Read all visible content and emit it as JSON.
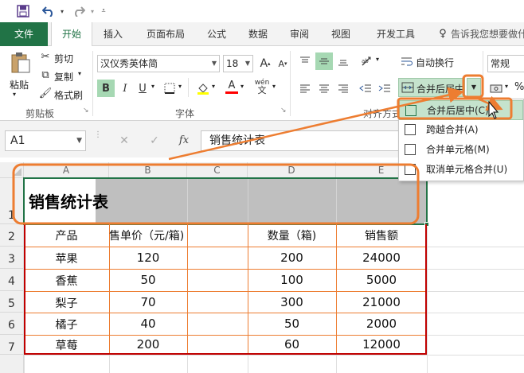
{
  "qat": {
    "save_icon": "save-icon",
    "undo_icon": "undo-icon",
    "redo_icon": "redo-icon"
  },
  "tabs": [
    {
      "label": "文件"
    },
    {
      "label": "开始"
    },
    {
      "label": "插入"
    },
    {
      "label": "页面布局"
    },
    {
      "label": "公式"
    },
    {
      "label": "数据"
    },
    {
      "label": "审阅"
    },
    {
      "label": "视图"
    },
    {
      "label": "开发工具"
    }
  ],
  "tell_me": "告诉我您想要做什",
  "clipboard": {
    "paste": "粘贴",
    "cut": "剪切",
    "copy": "复制",
    "format_painter": "格式刷",
    "group_label": "剪贴板"
  },
  "font": {
    "name": "汉仪秀英体简",
    "size": "18",
    "group_label": "字体",
    "bold": "B",
    "italic": "I",
    "underline": "U",
    "grow": "A",
    "shrink": "A",
    "font_color": "A",
    "phonetic": "wén"
  },
  "alignment": {
    "wrap_text": "自动换行",
    "merge_center": "合并后居中",
    "group_label": "对齐方式"
  },
  "number": {
    "format": "常规",
    "percent": "%"
  },
  "formula_bar": {
    "name_box": "A1",
    "fx": "fx",
    "content": "销售统计表"
  },
  "columns": [
    "A",
    "B",
    "C",
    "D",
    "E"
  ],
  "rows": [
    "1",
    "2",
    "3",
    "4",
    "5",
    "6",
    "7"
  ],
  "sheet": {
    "title": "销售统计表",
    "headers": [
      "产品",
      "售单价（元/箱)",
      "",
      "数量（箱)",
      "销售额"
    ],
    "data": [
      [
        "苹果",
        "120",
        "",
        "200",
        "24000"
      ],
      [
        "香蕉",
        "50",
        "",
        "100",
        "5000"
      ],
      [
        "梨子",
        "70",
        "",
        "300",
        "21000"
      ],
      [
        "橘子",
        "40",
        "",
        "50",
        "2000"
      ],
      [
        "草莓",
        "200",
        "",
        "60",
        "12000"
      ]
    ]
  },
  "merge_menu": {
    "items": [
      {
        "label": "合并后居中(C)"
      },
      {
        "label": "跨越合并(A)"
      },
      {
        "label": "合并单元格(M)"
      },
      {
        "label": "取消单元格合并(U)"
      }
    ]
  },
  "colors": {
    "excel_green": "#217346",
    "callout_orange": "#ed7d31",
    "selection_gray": "#bfbfbf",
    "table_border_red": "#c00000"
  }
}
